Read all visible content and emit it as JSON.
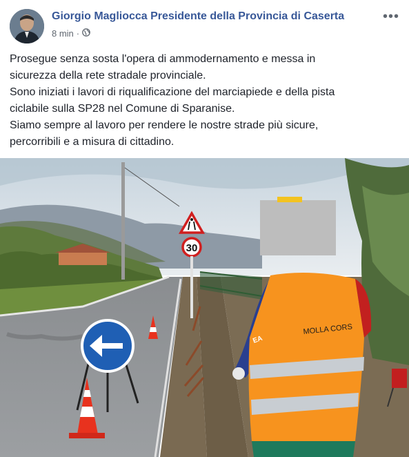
{
  "post": {
    "author": "Giorgio Magliocca Presidente della Provincia di Caserta",
    "time": "8 min",
    "separator": "·",
    "privacy_icon": "globe-icon",
    "more_icon": "more-options-icon",
    "lines": [
      "Prosegue senza sosta l'opera di ammodernamento e messa in",
      "sicurezza della rete stradale provinciale.",
      "Sono iniziati i lavori di riqualificazione del marciapiede e della pista",
      "ciclabile sulla SP28 nel Comune di Sparanise.",
      "Siamo sempre al lavoro per rendere le nostre strade più sicure,",
      "percorribili e a misura di cittadino."
    ]
  },
  "photo": {
    "speed_limit": "30",
    "vest_brand": "MOLLA CORS",
    "sleeve_text": "EA"
  },
  "colors": {
    "author_link": "#385898",
    "meta_gray": "#606770",
    "vest_orange": "#f7931e",
    "sign_blue": "#1f5fb4"
  }
}
